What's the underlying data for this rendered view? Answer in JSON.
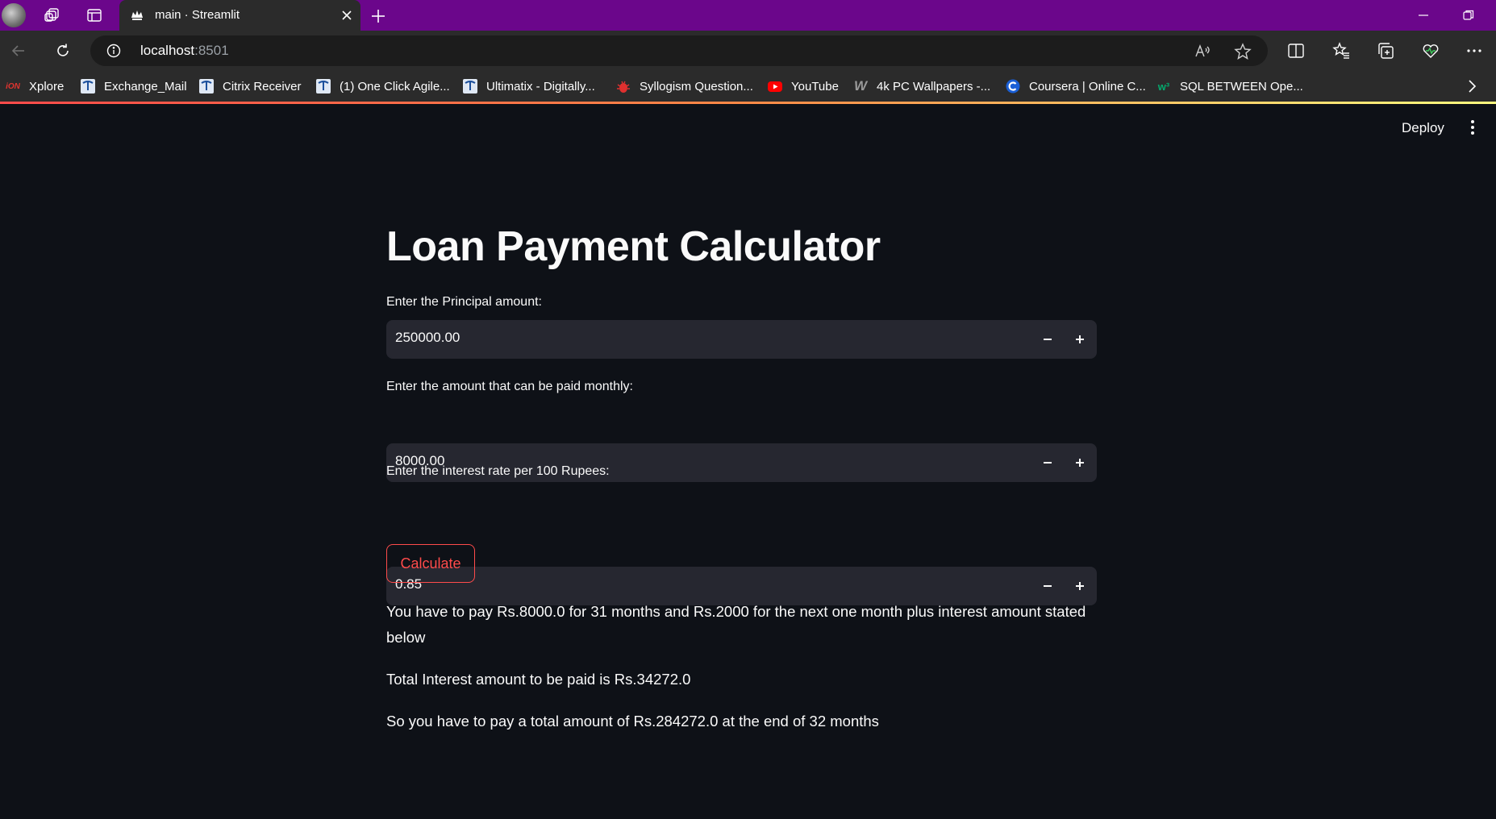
{
  "browser": {
    "tab_title": "main · Streamlit",
    "url_host": "localhost",
    "url_port": ":8501",
    "accent": "#6b068b"
  },
  "bookmarks": [
    {
      "label": "Xplore",
      "icon": "xplore-icon"
    },
    {
      "label": "Exchange_Mail",
      "icon": "tata-icon"
    },
    {
      "label": "Citrix Receiver",
      "icon": "tata-icon"
    },
    {
      "label": "(1) One Click Agile...",
      "icon": "tata-icon"
    },
    {
      "label": "Ultimatix - Digitally...",
      "icon": "tata-icon"
    },
    {
      "label": "Syllogism Question...",
      "icon": "bug-icon"
    },
    {
      "label": "YouTube",
      "icon": "youtube-icon"
    },
    {
      "label": "4k PC Wallpapers -...",
      "icon": "w-icon"
    },
    {
      "label": "Coursera | Online C...",
      "icon": "coursera-icon"
    },
    {
      "label": "SQL BETWEEN Ope...",
      "icon": "w3-icon"
    }
  ],
  "header": {
    "deploy_label": "Deploy"
  },
  "main": {
    "title": "Loan Payment Calculator",
    "fields": [
      {
        "label": "Enter the Principal amount:",
        "value": "250000.00"
      },
      {
        "label": "Enter the amount that can be paid monthly:",
        "value": "8000.00"
      },
      {
        "label": "Enter the interest rate per 100 Rupees:",
        "value": "0.85"
      }
    ],
    "calculate_label": "Calculate",
    "results": [
      "You have to pay Rs.8000.0 for 31 months and Rs.2000 for the next one month plus interest amount stated below",
      "Total Interest amount to be paid is Rs.34272.0",
      "So you have to pay a total amount of Rs.284272.0 at the end of 32 months"
    ]
  },
  "colors": {
    "background": "#0e1117",
    "input_bg": "#262730",
    "primary": "#ff4b4b",
    "text": "#fafafa"
  }
}
